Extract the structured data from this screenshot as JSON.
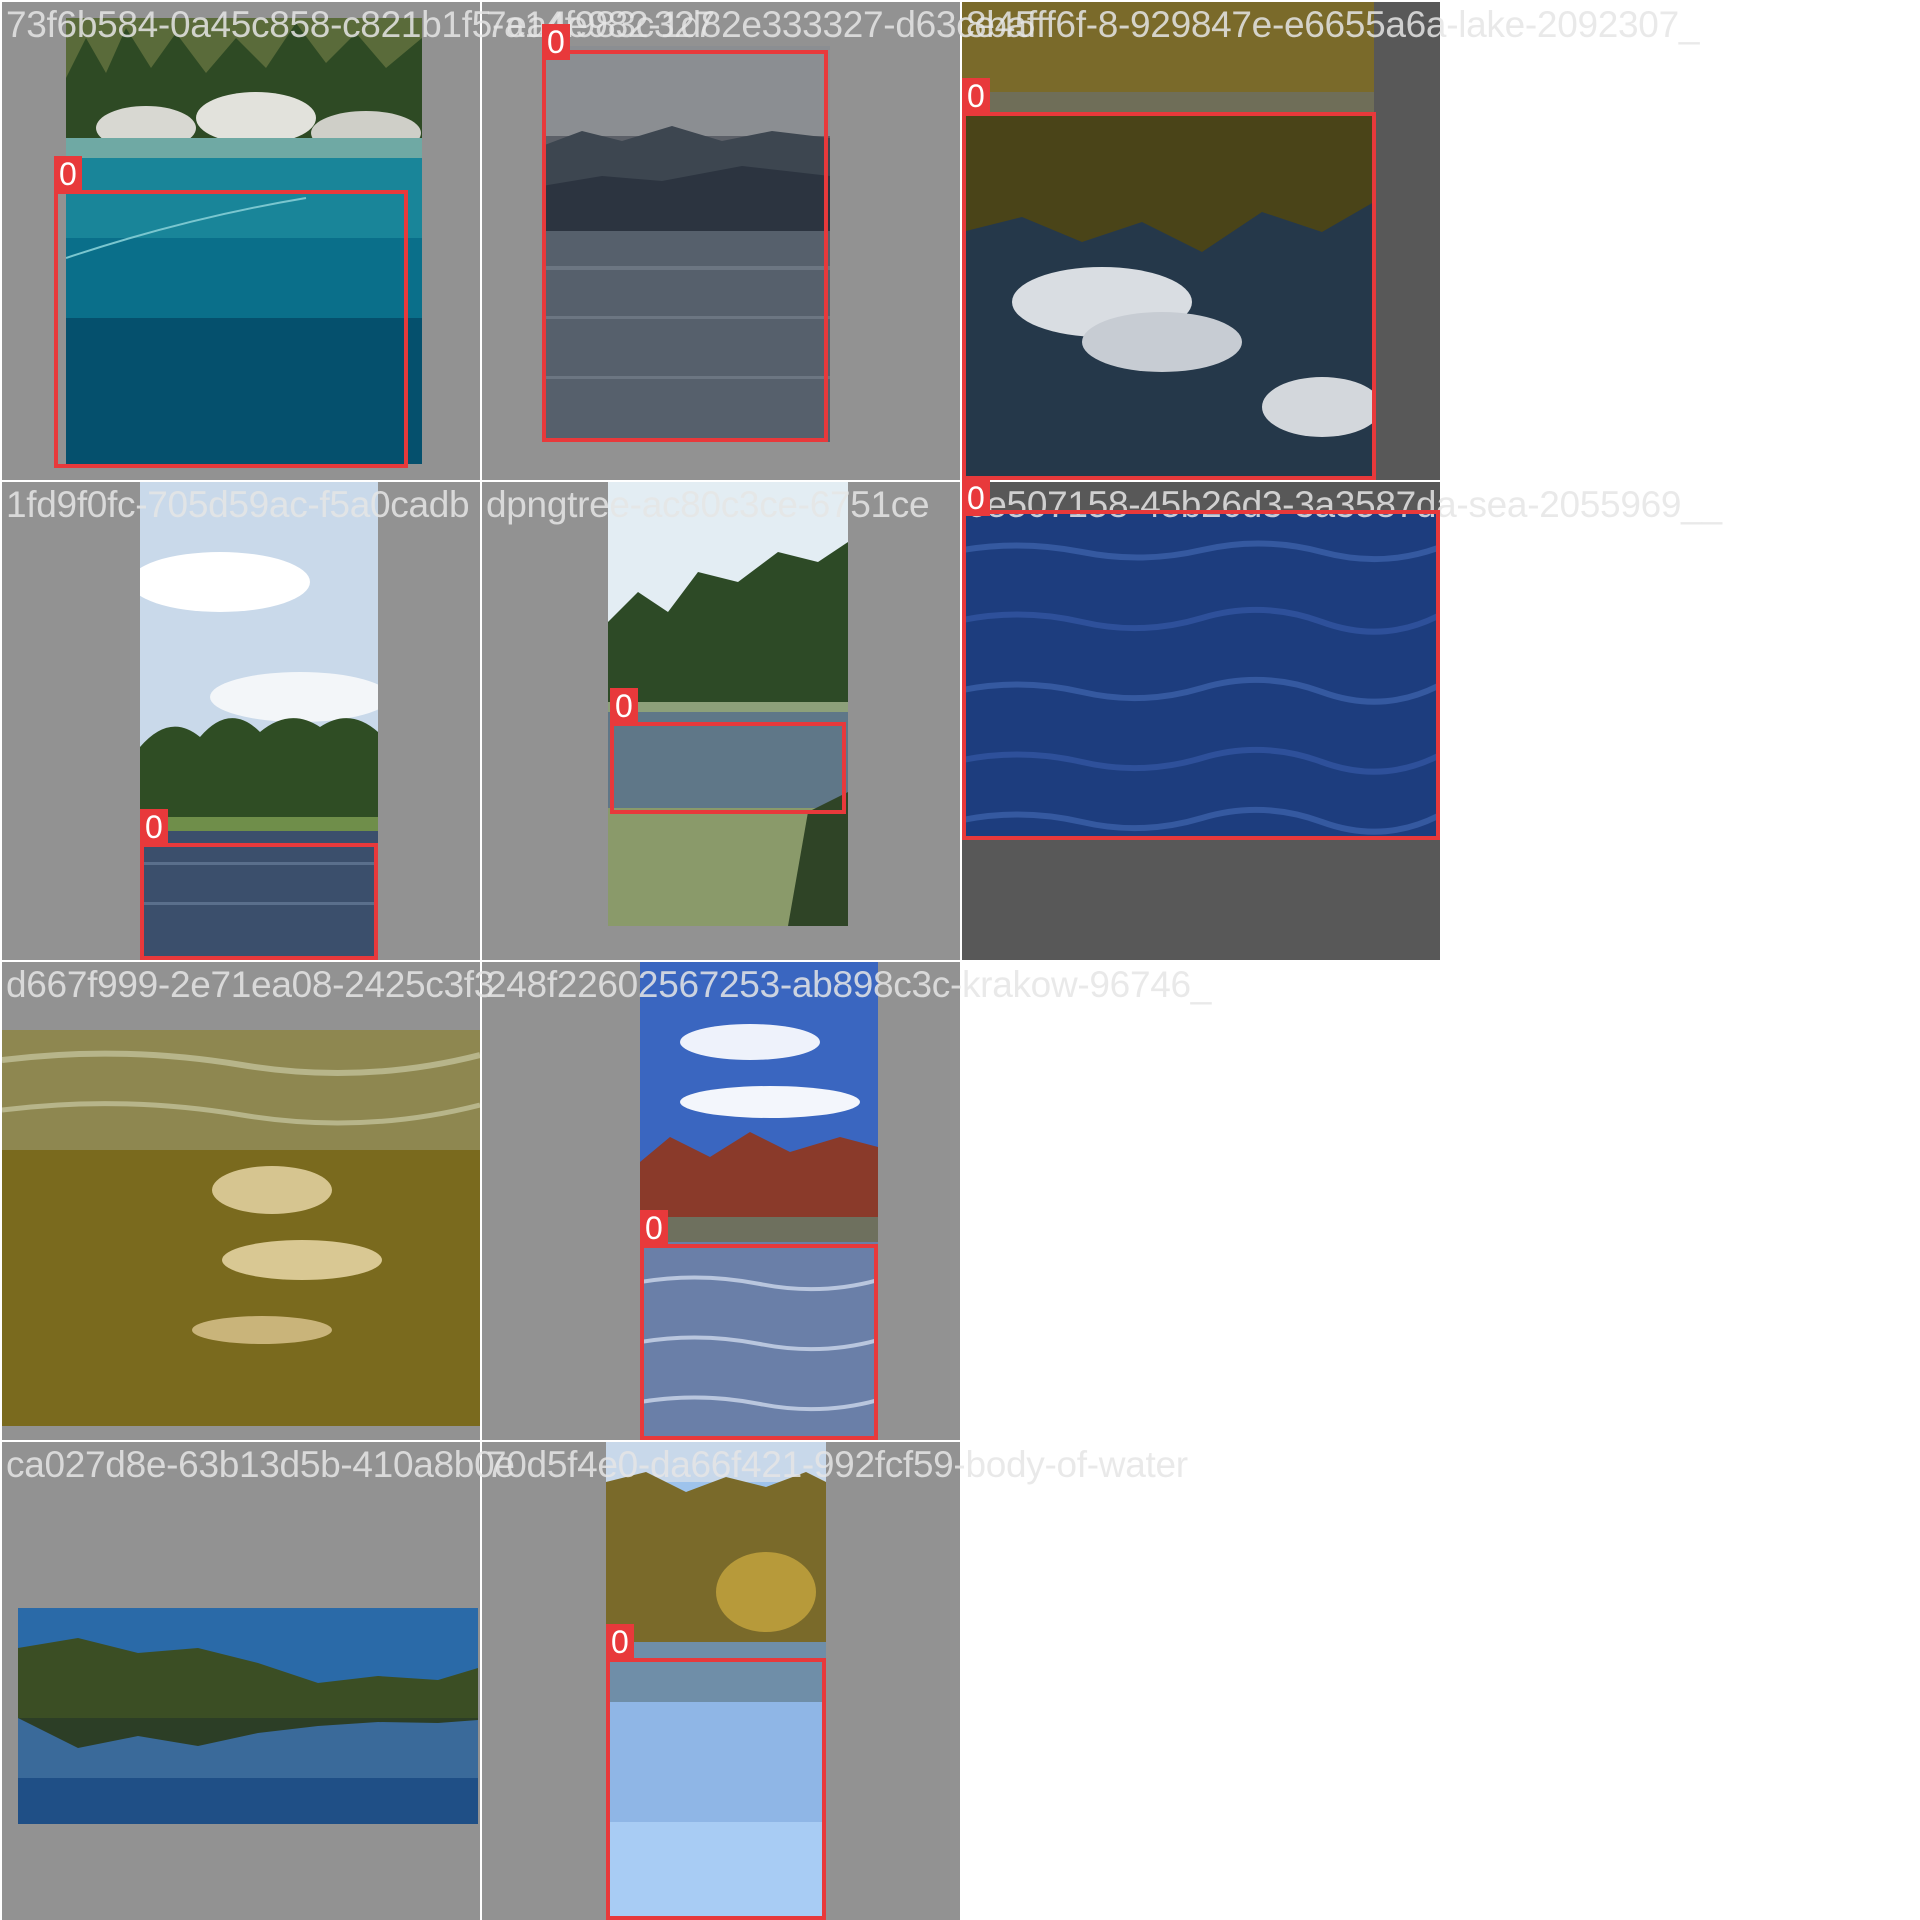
{
  "tiles": [
    {
      "filename": "73f6b584-0a45c858-c821b1f5-a14f983c327",
      "label": "0"
    },
    {
      "filename": "7ea4e982-1d82e333327-d63ce45",
      "label": "0"
    },
    {
      "filename": "8bafff6f-8-929847e-e6655a6a-lake-2092307_",
      "label": "0"
    },
    {
      "filename": "1fd9f0fc-705d59ac-f5a0cadb",
      "label": "0"
    },
    {
      "filename": "dpngtree-ac80c3ce-6751ce",
      "label": "0"
    },
    {
      "filename": "6e507158-45b26d3-3a3587da-sea-2055969__",
      "label": "0"
    },
    {
      "filename": "d667f999-2e71ea08-2425c3f3"
    },
    {
      "filename": "248f22602567253-ab898c3c-krakow-96746_",
      "label": "0"
    },
    {
      "filename": "ca027d8e-63b13d5b-410a8b0e"
    },
    {
      "filename": "70d5f4e0-da66f421-992fcf59-body-of-water",
      "label": "0"
    }
  ],
  "colors": {
    "box": "#e8393b",
    "mosaic_bg": "#929292",
    "mosaic_dark": "#585858"
  }
}
